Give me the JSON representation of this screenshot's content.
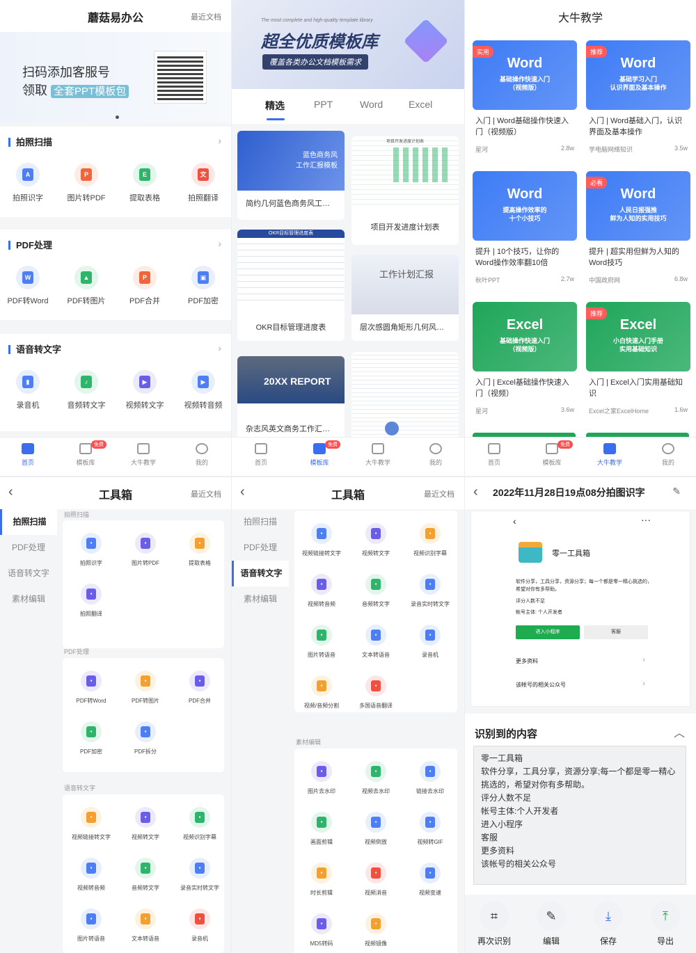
{
  "p1": {
    "title": "蘑菇易办公",
    "recent": "最近文档",
    "banner_l1": "扫码添加客服号",
    "banner_l2": "领取",
    "banner_tag": "全套PPT模板包",
    "sections": [
      {
        "title": "拍照扫描",
        "tools": [
          "拍照识字",
          "图片转PDF",
          "提取表格",
          "拍照翻译"
        ]
      },
      {
        "title": "PDF处理",
        "tools": [
          "PDF转Word",
          "PDF转图片",
          "PDF合并",
          "PDF加密"
        ]
      },
      {
        "title": "语音转文字",
        "tools": [
          "录音机",
          "音频转文字",
          "视频转文字",
          "视频转音频"
        ]
      }
    ]
  },
  "tabbar": {
    "home": "首页",
    "lib": "模板库",
    "teach": "大牛教学",
    "me": "我的",
    "free": "免费"
  },
  "p2": {
    "banner_en": "The most complete and high-quality template library",
    "banner_title": "超全优质模板库",
    "banner_sub": "覆盖各类办公文档模板需求",
    "tabs": [
      "精选",
      "PPT",
      "Word",
      "Excel"
    ],
    "cards": [
      {
        "label": "简约几何蓝色商务风工…",
        "thumb": "蓝色商务风\n工作汇报模板"
      },
      {
        "label": "项目开发进度计划表",
        "thumb": "项目开发进度计划表"
      },
      {
        "label": "OKR目标管理进度表",
        "thumb": "OKR目标管理进度表"
      },
      {
        "label": "层次感圆角矩形几何风…",
        "thumb": "工作计划汇报"
      },
      {
        "label": "杂志风英文商务工作汇…",
        "thumb": "20XX REPORT"
      },
      {
        "label": "",
        "thumb": ""
      }
    ]
  },
  "p3": {
    "title": "大牛教学",
    "videos": [
      {
        "tag": "实用",
        "app": "Word",
        "cover": "基础操作快速入门\n（视频版）",
        "title": "入门 | Word基础操作快速入门（视频版）",
        "author": "星河",
        "views": "2.8w",
        "color": "#3d7bf5"
      },
      {
        "tag": "推荐",
        "app": "Word",
        "cover": "基础学习入门\n认识界面及基本操作",
        "title": "入门 | Word基础入门，认识界面及基本操作",
        "author": "学电脑网络知识",
        "views": "3.5w",
        "color": "#3d7bf5"
      },
      {
        "tag": "",
        "app": "Word",
        "cover": "提高操作效率的\n十个小技巧",
        "title": "提升 | 10个技巧，让你的Word操作效率翻10倍",
        "author": "秋叶PPT",
        "views": "2.7w",
        "color": "#3d7bf5"
      },
      {
        "tag": "必看",
        "app": "Word",
        "cover": "人民日报强推\n鲜为人知的实用技巧",
        "title": "提升 | 超实用但鲜为人知的Word技巧",
        "author": "中国政府网",
        "views": "6.8w",
        "color": "#3d7bf5"
      },
      {
        "tag": "",
        "app": "Excel",
        "cover": "基础操作快速入门\n（视频版）",
        "title": "入门 | Excel基础操作快速入门（视频）",
        "author": "星河",
        "views": "3.6w",
        "color": "#1fa65a"
      },
      {
        "tag": "推荐",
        "app": "Excel",
        "cover": "小白快速入门手册\n实用基础知识",
        "title": "入门 | Excel入门实用基础知识",
        "author": "Excel之家ExcelHome",
        "views": "1.6w",
        "color": "#1fa65a"
      }
    ]
  },
  "p4": {
    "title": "工具箱",
    "recent": "最近文档",
    "side": [
      "拍照扫描",
      "PDF处理",
      "语音转文字",
      "素材编辑"
    ],
    "groups": [
      {
        "label": "拍照扫描",
        "tools": [
          "拍照识字",
          "图片转PDF",
          "提取表格",
          "拍照翻译"
        ]
      },
      {
        "label": "PDF处理",
        "tools": [
          "PDF转Word",
          "PDF转图片",
          "PDF合并",
          "PDF加密",
          "PDF拆分"
        ]
      },
      {
        "label": "语音转文字",
        "tools": [
          "视频链接转文字",
          "视频转文字",
          "视频识别字幕",
          "视频转音频",
          "音频转文字",
          "录音实时转文字",
          "图片转语音",
          "文本转语音",
          "录音机"
        ]
      }
    ]
  },
  "p5": {
    "title": "工具箱",
    "recent": "最近文档",
    "side": [
      "拍照扫描",
      "PDF处理",
      "语音转文字",
      "素材编辑"
    ],
    "tools_a": [
      "视频链接转文字",
      "视频转文字",
      "视频识别字幕",
      "视频转音频",
      "音频转文字",
      "录音实时转文字",
      "图片转语音",
      "文本转语音",
      "录音机",
      "视频/音频分割",
      "多国语音翻译"
    ],
    "label_b": "素材编辑",
    "tools_b": [
      "图片去水印",
      "视频去水印",
      "链接去水印",
      "画面剪辑",
      "视频倒放",
      "视频转GIF",
      "时长剪辑",
      "视频消音",
      "视频变速",
      "MD5转码",
      "视频镜像"
    ]
  },
  "p6": {
    "title": "2022年11月28日19点08分拍图识字",
    "mini_name": "零一工具箱",
    "mini_desc": "软件分享，工具分享，资源分享；每一个都是零一精心挑选的，希望对你有多帮助。",
    "mini_rate": "评分人数不足",
    "mini_owner": "帐号主体: 个人开发者",
    "btn_enter": "进入小程序",
    "btn_service": "客服",
    "row1": "更多资料",
    "row2": "该帐号的相关公众号",
    "result_title": "识别到的内容",
    "result_lines": [
      "零一工具箱",
      "软件分享，工具分享，资源分享;每一个都是零一精心挑选的，希望对你有多帮助。",
      "评分人数不足",
      "帐号主体:个人开发者",
      "进入小程序",
      "客服",
      "更多资料",
      "该帐号的相关公众号"
    ],
    "actions": [
      "再次识别",
      "编辑",
      "保存",
      "导出"
    ]
  }
}
